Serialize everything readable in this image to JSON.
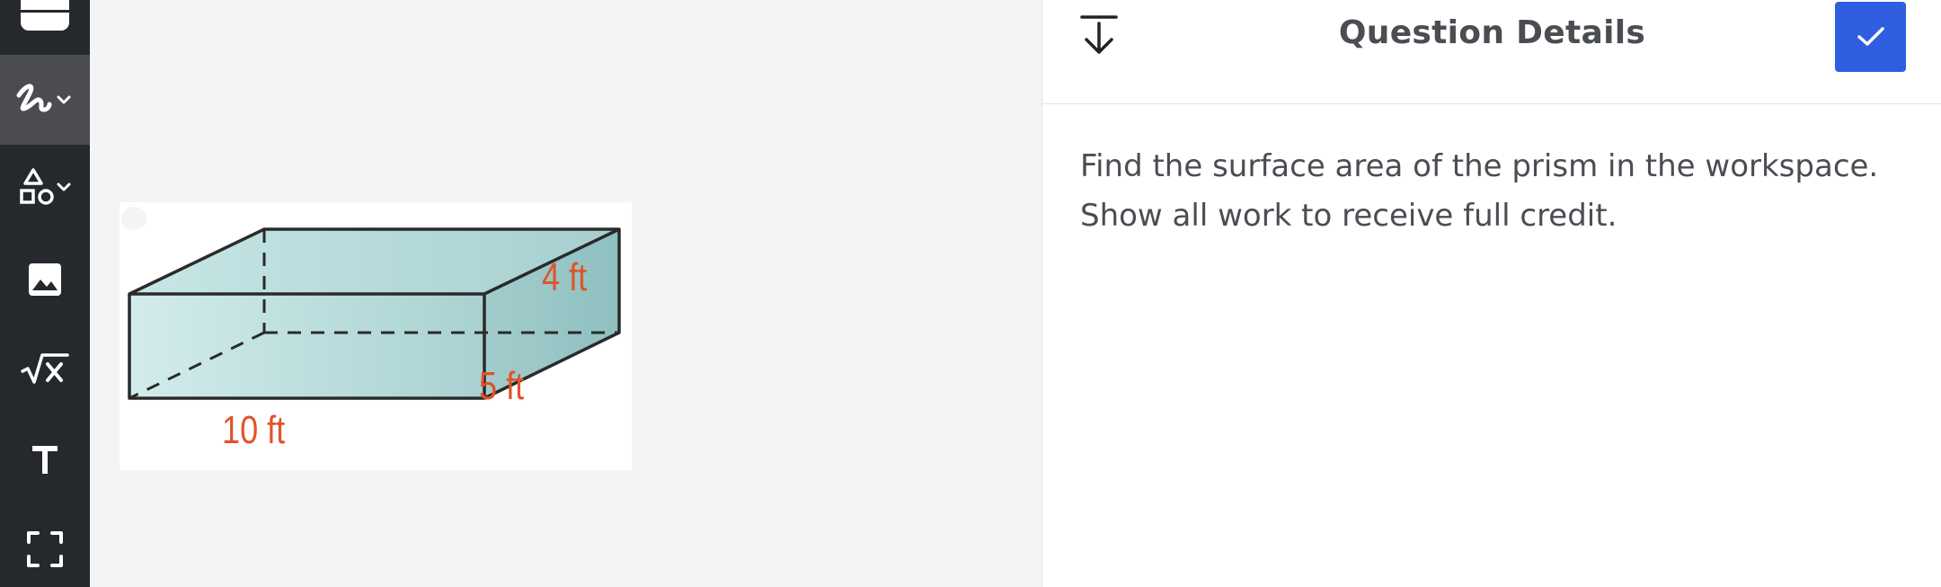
{
  "toolbar": {
    "tools": [
      {
        "name": "menu",
        "icon": "menu-icon"
      },
      {
        "name": "draw",
        "icon": "pen-icon",
        "active": true
      },
      {
        "name": "shapes",
        "icon": "shapes-icon"
      },
      {
        "name": "image",
        "icon": "image-icon"
      },
      {
        "name": "math",
        "icon": "sqrt-x-icon",
        "label": "√x"
      },
      {
        "name": "text",
        "icon": "text-icon",
        "label": "T"
      },
      {
        "name": "fullscreen",
        "icon": "fullscreen-icon"
      }
    ]
  },
  "workspace": {
    "prism": {
      "length_label": "10 ft",
      "width_label": "5 ft",
      "height_label": "4 ft"
    }
  },
  "panel": {
    "title": "Question Details",
    "question_lines": [
      "Find the surface area of the prism in the workspace.",
      "Show all work to receive full credit."
    ]
  },
  "colors": {
    "toolbar_bg": "#25282c",
    "active_tool_bg": "#4a4c50",
    "accent": "#2f5fe0",
    "dimension_label": "#e0532a",
    "prism_fill": "#b8dcdc"
  }
}
